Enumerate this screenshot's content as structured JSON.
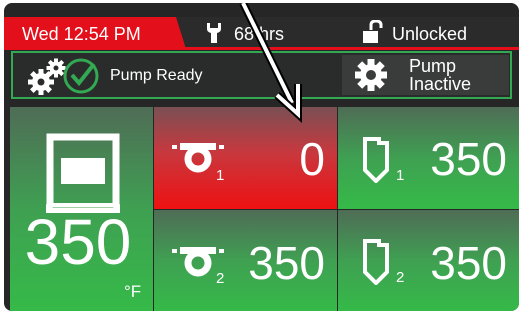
{
  "status_bar": {
    "datetime": "Wed 12:54 PM",
    "hours": "68 hrs",
    "lock_status": "Unlocked"
  },
  "info_panel": {
    "pump_status": "Pump Ready",
    "pump_button_line1": "Pump",
    "pump_button_line2": "Inactive"
  },
  "tiles": {
    "temperature": {
      "value": "350",
      "unit": "°F"
    },
    "hose_1": {
      "index": "1",
      "value": "0"
    },
    "applicator_1": {
      "index": "1",
      "value": "350"
    },
    "hose_2": {
      "index": "2",
      "value": "350"
    },
    "applicator_2": {
      "index": "2",
      "value": "350"
    }
  },
  "colors": {
    "alarm_red": "#e3101c",
    "ready_green": "#32a952",
    "panel_dark": "#262626"
  },
  "icons": [
    "wrench-icon",
    "unlock-icon",
    "gears-check-icon",
    "gear-icon",
    "tank-icon",
    "hose-icon",
    "applicator-icon"
  ]
}
